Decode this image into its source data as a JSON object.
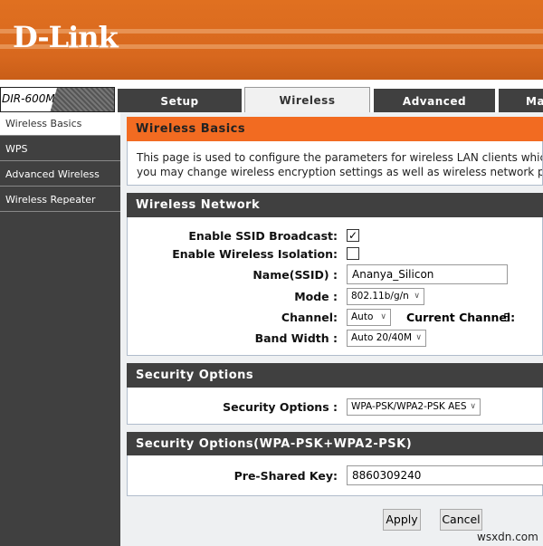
{
  "brand": {
    "logo": "D-Link",
    "model": "DIR-600M"
  },
  "tabs": [
    {
      "label": "Setup"
    },
    {
      "label": "Wireless",
      "active": true
    },
    {
      "label": "Advanced"
    },
    {
      "label": "Ma"
    }
  ],
  "sidebar": {
    "items": [
      {
        "label": "Wireless Basics",
        "active": true
      },
      {
        "label": "WPS"
      },
      {
        "label": "Advanced Wireless"
      },
      {
        "label": "Wireless Repeater"
      }
    ]
  },
  "basics": {
    "title": "Wireless Basics",
    "desc1": "This page is used to configure the parameters for wireless LAN clients which may c",
    "desc2": "you may change wireless encryption settings as well as wireless network paramete"
  },
  "network": {
    "title": "Wireless Network",
    "ssid_broadcast_label": "Enable SSID Broadcast:",
    "ssid_broadcast": "✓",
    "isolation_label": "Enable Wireless Isolation:",
    "name_label": "Name(SSID) :",
    "name_value": "Ananya_Silicon",
    "mode_label": "Mode :",
    "mode_value": "802.11b/g/n",
    "channel_label": "Channel:",
    "channel_value": "Auto",
    "current_channel_label": "Current Channel:",
    "current_channel_value": "5",
    "bandwidth_label": "Band Width :",
    "bandwidth_value": "Auto 20/40M"
  },
  "security": {
    "title": "Security Options",
    "label": "Security Options :",
    "value": "WPA-PSK/WPA2-PSK AES"
  },
  "wpa": {
    "title": "Security Options(WPA-PSK+WPA2-PSK)",
    "psk_label": "Pre-Shared Key:",
    "psk_value": "8860309240"
  },
  "buttons": {
    "apply": "Apply",
    "cancel": "Cancel"
  },
  "watermark": "wsxdn.com",
  "colors": {
    "orange": "#f26b21",
    "dark": "#404040"
  }
}
